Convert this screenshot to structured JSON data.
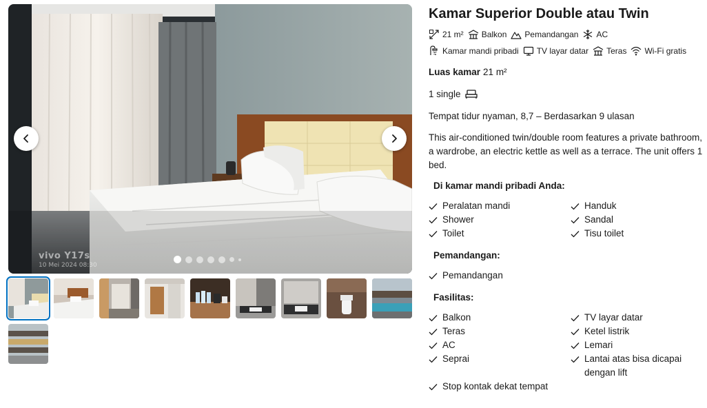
{
  "gallery": {
    "watermark_brand": "vivo Y17s",
    "watermark_date": "10 Mei 2024 08:30",
    "prev_icon": "chevron-left-icon",
    "next_icon": "chevron-right-icon",
    "active_slide": 1,
    "thumbnail_count": 10
  },
  "room": {
    "title": "Kamar Superior Double atau Twin",
    "amenities_row1": [
      {
        "icon": "room-size-icon",
        "label": "21 m²"
      },
      {
        "icon": "balcony-icon",
        "label": "Balkon"
      },
      {
        "icon": "mountain-view-icon",
        "label": "Pemandangan"
      },
      {
        "icon": "snowflake-ac-icon",
        "label": "AC"
      }
    ],
    "amenities_row2": [
      {
        "icon": "shower-icon",
        "label": "Kamar mandi pribadi"
      },
      {
        "icon": "tv-icon",
        "label": "TV layar datar"
      },
      {
        "icon": "terrace-icon",
        "label": "Teras"
      },
      {
        "icon": "wifi-icon",
        "label": "Wi-Fi gratis"
      }
    ],
    "size_label": "Luas kamar",
    "size_value": "21 m²",
    "beds": "1 single",
    "rating_text": "Tempat tidur nyaman, 8,7 – Berdasarkan 9 ulasan",
    "description": "This air-conditioned twin/double room features a private bathroom, a wardrobe, an electric kettle as well as a terrace. The unit offers 1 bed."
  },
  "bathroom": {
    "title": "Di kamar mandi pribadi Anda:",
    "items": [
      "Peralatan mandi",
      "Handuk",
      "Shower",
      "Sandal",
      "Toilet",
      "Tisu toilet"
    ]
  },
  "view": {
    "title": "Pemandangan:",
    "items": [
      "Pemandangan"
    ]
  },
  "facilities": {
    "title": "Fasilitas:",
    "items": [
      "Balkon",
      "TV layar datar",
      "Teras",
      "Ketel listrik",
      "AC",
      "Lemari",
      "Seprai",
      "Lantai atas bisa dicapai dengan lift",
      "Stop kontak dekat tempat",
      ""
    ]
  },
  "colors": {
    "accent": "#0071c2",
    "text": "#1a1a1a"
  }
}
